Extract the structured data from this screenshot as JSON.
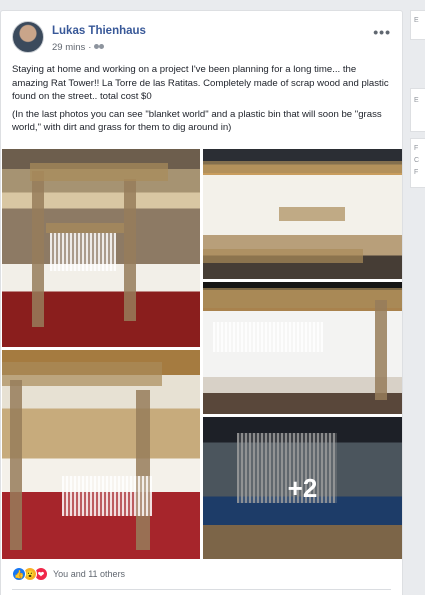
{
  "post": {
    "author": "Lukas Thienhaus",
    "time": "29 mins",
    "separator": "·",
    "audience_icon": "friends-icon",
    "more_icon": "more-options-icon",
    "more_label": "•••",
    "body": [
      "Staying at home and working on a project I've been planning for a long time... the amazing Rat Tower!! La Torre de las Ratitas. Completely made of scrap wood and plastic found on the street.. total cost $0",
      "(In the last photos you can see \"blanket world\" and a plastic bin that will soon be \"grass world,\" with dirt and grass for them to dig around in)"
    ],
    "photos_more": "+2",
    "reactions": {
      "icons": [
        "like-icon",
        "wow-icon",
        "love-icon"
      ],
      "like_glyph": "👍",
      "wow_glyph": "😮",
      "love_glyph": "❤",
      "summary": "You and 11 others"
    }
  },
  "right_rail": {
    "letters": [
      "E",
      "E",
      "F",
      "C",
      "F"
    ]
  }
}
